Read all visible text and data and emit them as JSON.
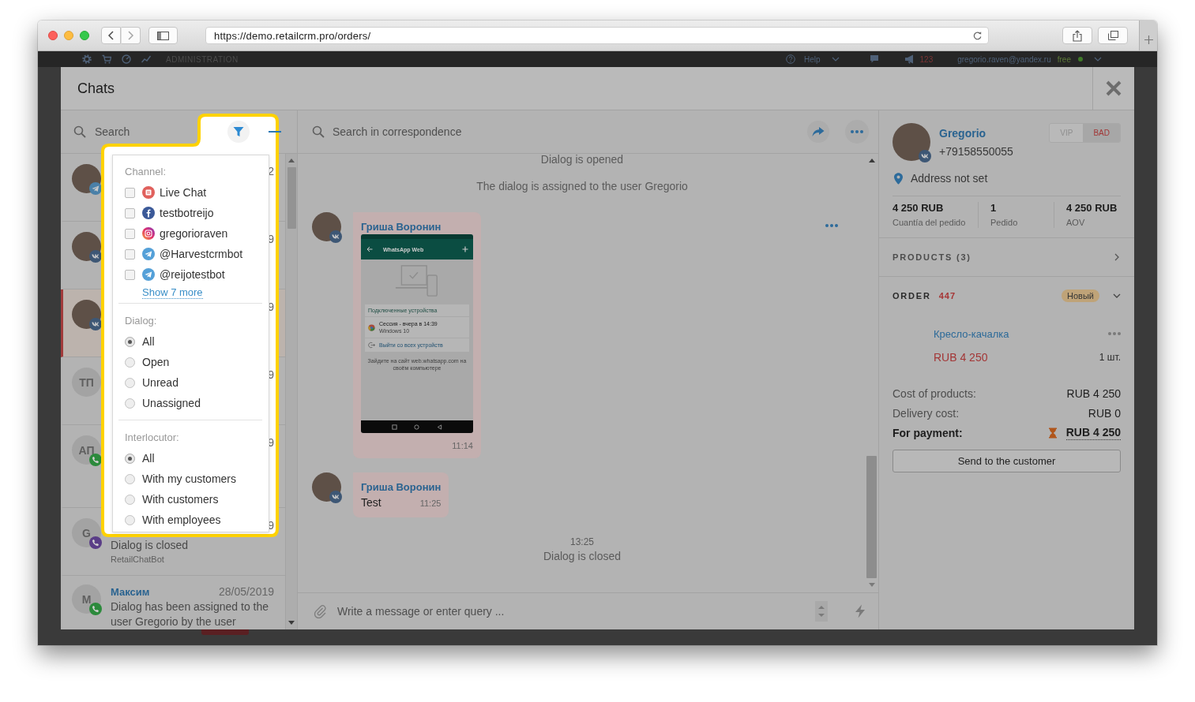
{
  "browser": {
    "url": "https://demo.retailcrm.pro/orders/"
  },
  "app_header": {
    "section": "ADMINISTRATION",
    "help": "Help",
    "notifications": "123",
    "user": "gregorio.raven@yandex.ru",
    "plan": "free"
  },
  "modal": {
    "title": "Chats"
  },
  "chat_list": {
    "search_placeholder": "Search",
    "items": [
      {
        "avatar": {
          "kind": "photo"
        },
        "badge": {
          "kind": "telegram"
        },
        "selected": false,
        "date": "2"
      },
      {
        "avatar": {
          "kind": "photo"
        },
        "badge": {
          "kind": "vk"
        },
        "selected": false,
        "date": "9"
      },
      {
        "avatar": {
          "kind": "photo"
        },
        "badge": {
          "kind": "vk"
        },
        "selected": true,
        "date": "9"
      },
      {
        "avatar": {
          "kind": "initials",
          "initials": "ТП"
        },
        "selected": false,
        "date": "9"
      },
      {
        "avatar": {
          "kind": "initials",
          "initials": "АП"
        },
        "badge": {
          "kind": "whatsapp"
        },
        "selected": false,
        "date": "9"
      },
      {
        "avatar": {
          "kind": "initials",
          "initials": "G"
        },
        "badge": {
          "kind": "viber"
        },
        "selected": false,
        "date": "9",
        "message": "Dialog is closed",
        "author": "RetailChatBot"
      },
      {
        "avatar": {
          "kind": "initials",
          "initials": "М"
        },
        "badge": {
          "kind": "whatsapp"
        },
        "selected": false,
        "name": "Максим",
        "date": "28/05/2019",
        "message": "Dialog has been assigned to the user Gregorio by the user"
      }
    ]
  },
  "filter": {
    "channel_label": "Channel:",
    "channels": [
      {
        "name": "Live Chat",
        "kind": "livechat",
        "checked": false
      },
      {
        "name": "testbotreijo",
        "kind": "facebook",
        "checked": false
      },
      {
        "name": "gregorioraven",
        "kind": "instagram",
        "checked": false
      },
      {
        "name": "@Harvestcrmbot",
        "kind": "telegram",
        "checked": false
      },
      {
        "name": "@reijotestbot",
        "kind": "telegram",
        "checked": false
      }
    ],
    "show_more": "Show 7 more",
    "dialog_label": "Dialog:",
    "dialog_options": [
      {
        "label": "All",
        "selected": true
      },
      {
        "label": "Open",
        "selected": false
      },
      {
        "label": "Unread",
        "selected": false
      },
      {
        "label": "Unassigned",
        "selected": false
      }
    ],
    "interlocutor_label": "Interlocutor:",
    "interlocutor_options": [
      {
        "label": "All",
        "selected": true
      },
      {
        "label": "With my customers",
        "selected": false
      },
      {
        "label": "With customers",
        "selected": false
      },
      {
        "label": "With employees",
        "selected": false
      }
    ]
  },
  "conversation": {
    "search_placeholder": "Search in correspondence",
    "timeline": [
      {
        "kind": "system",
        "text": "Dialog is opened"
      },
      {
        "kind": "system",
        "text": "The dialog is assigned to the user Gregorio"
      },
      {
        "kind": "message",
        "author": "Гриша Воронин",
        "badge": {
          "kind": "vk"
        },
        "attachment": {
          "app_title": "WhatsApp Web",
          "section": "Подключенные устройства",
          "session": "Сессия - вчера в 14:39",
          "device": "Windows 10",
          "logout": "Выйти со всех устройств",
          "hint": "Зайдите на сайт web.whatsapp.com на своём компьютере"
        },
        "time": "11:14"
      },
      {
        "kind": "message",
        "author": "Гриша Воронин",
        "badge": {
          "kind": "vk"
        },
        "text": "Test",
        "time": "11:25"
      },
      {
        "kind": "system",
        "time": "13:25",
        "text": "Dialog is closed"
      }
    ],
    "composer_placeholder": "Write a message or enter query ..."
  },
  "customer": {
    "name": "Gregorio",
    "phone": "+79158550055",
    "badge": {
      "kind": "vk"
    },
    "tags": [
      {
        "label": "VIP",
        "selected": false
      },
      {
        "label": "BAD",
        "selected": true
      }
    ],
    "address": "Address not set",
    "stats": [
      {
        "value": "4 250 RUB",
        "label": "Cuantía del pedido"
      },
      {
        "value": "1",
        "label": "Pedido"
      },
      {
        "value": "4 250 RUB",
        "label": "AOV"
      }
    ],
    "products": {
      "title": "PRODUCTS (3)",
      "expanded": false
    },
    "order": {
      "label": "ORDER",
      "number": "447",
      "status": "Новый",
      "expanded": true,
      "items": [
        {
          "name": "Кресло-качалка",
          "price": "RUB 4 250",
          "quantity": "1 шт."
        }
      ],
      "totals": [
        {
          "label": "Cost of products:",
          "value": "RUB 4 250",
          "kind": "plain"
        },
        {
          "label": "Delivery cost:",
          "value": "RUB 0",
          "kind": "plain"
        },
        {
          "label": "For payment:",
          "value": "RUB 4 250",
          "kind": "due"
        }
      ]
    },
    "send_button": "Send to the customer"
  }
}
